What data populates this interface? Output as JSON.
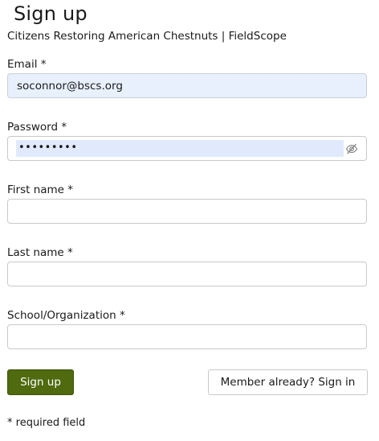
{
  "page": {
    "title": "Sign up",
    "subtitle": "Citizens Restoring American Chestnuts | FieldScope"
  },
  "form": {
    "email": {
      "label": "Email *",
      "value": "soconnor@bscs.org"
    },
    "password": {
      "label": "Password *",
      "masked_value": "•••••••••",
      "toggle_icon": "eye-slash-icon"
    },
    "first_name": {
      "label": "First name *",
      "value": ""
    },
    "last_name": {
      "label": "Last name *",
      "value": ""
    },
    "organization": {
      "label": "School/Organization *",
      "value": ""
    }
  },
  "actions": {
    "signup_label": "Sign up",
    "signin_label": "Member already? Sign in"
  },
  "footer": {
    "required_note": "* required field"
  },
  "colors": {
    "primary_button": "#4f6a0f",
    "autofill_background": "#e8f0fe",
    "border": "#c9c9c9"
  }
}
